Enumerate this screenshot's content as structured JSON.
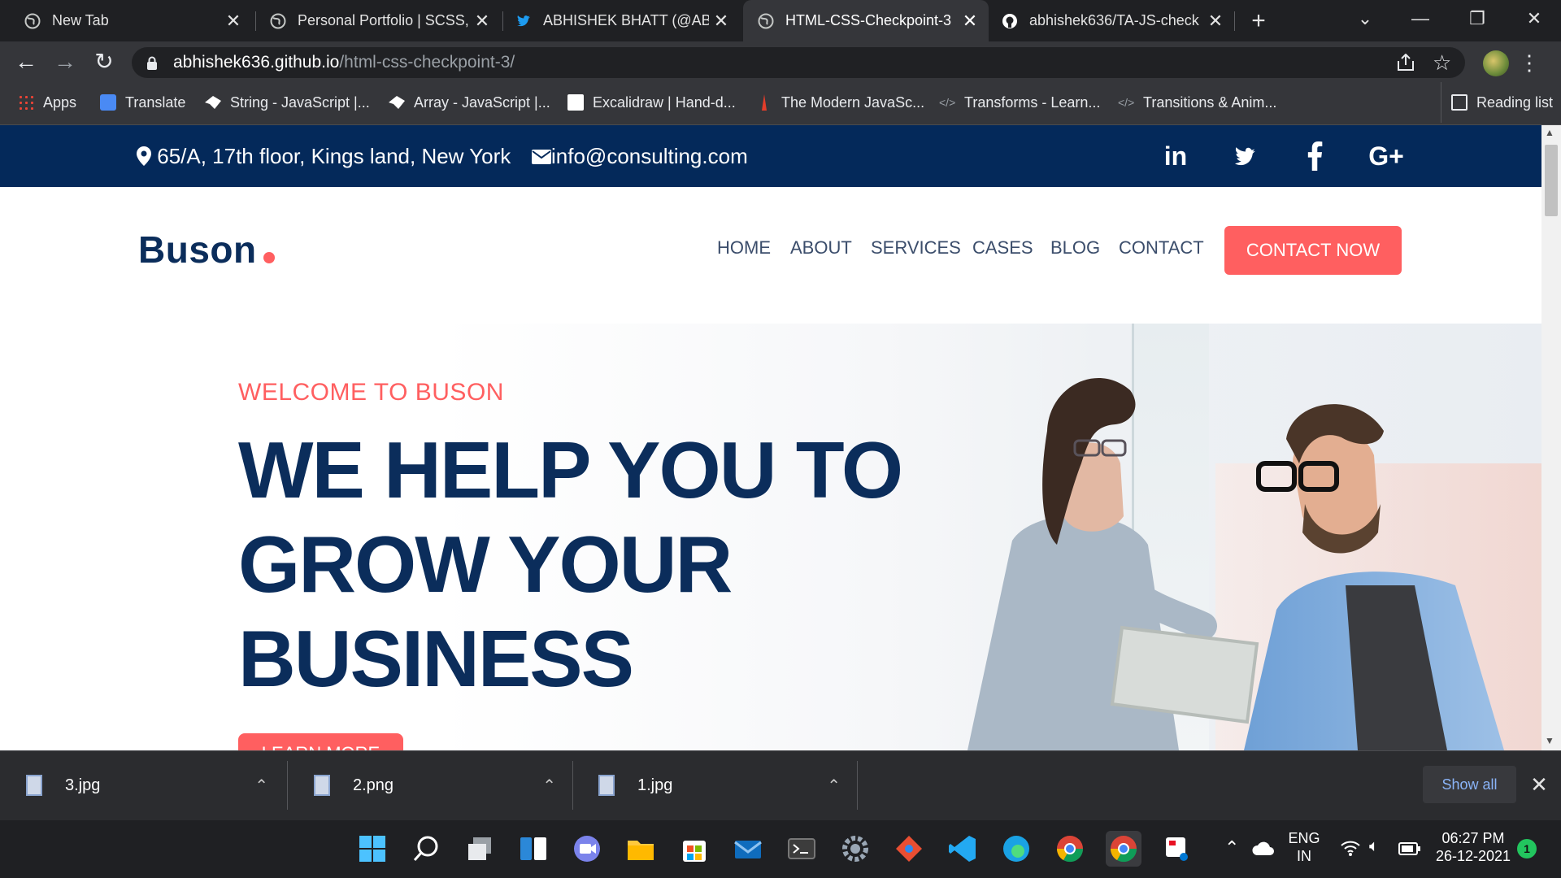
{
  "browser": {
    "tabs": [
      {
        "title": "New Tab",
        "active": false
      },
      {
        "title": "Personal Portfolio | SCSS, ",
        "active": false
      },
      {
        "title": "ABHISHEK BHATT (@ABH",
        "active": false
      },
      {
        "title": "HTML-CSS-Checkpoint-3",
        "active": true
      },
      {
        "title": "abhishek636/TA-JS-check",
        "active": false
      }
    ],
    "new_tab": "+",
    "window_controls": {
      "dropdown": "⌄",
      "minimize": "—",
      "restore": "❐",
      "close": "✕"
    },
    "url_host": "abhishek636.github.io",
    "url_path": "/html-css-checkpoint-3/",
    "bookmarks": [
      {
        "label": "Apps",
        "icon": "apps-grid-icon",
        "color": "#4285f4"
      },
      {
        "label": "Translate",
        "icon": "translate-icon",
        "color": "#4a8af4"
      },
      {
        "label": "String - JavaScript |...",
        "icon": "mdn-icon",
        "color": "#ffffff"
      },
      {
        "label": "Array - JavaScript |...",
        "icon": "mdn-icon",
        "color": "#ffffff"
      },
      {
        "label": "Excalidraw | Hand-d...",
        "icon": "excalidraw-icon",
        "color": "#ffffff"
      },
      {
        "label": "The Modern JavaSc...",
        "icon": "js-info-icon",
        "color": "#e33d2a"
      },
      {
        "label": "Transforms - Learn...",
        "icon": "code-icon",
        "color": "#9aa0a6"
      },
      {
        "label": "Transitions & Anim...",
        "icon": "code-icon",
        "color": "#9aa0a6"
      }
    ],
    "reading_list": "Reading list"
  },
  "page": {
    "topbar": {
      "address": "65/A, 17th floor, Kings land, New York",
      "email": "info@consulting.com",
      "social": [
        "in",
        "t",
        "f",
        "G+"
      ]
    },
    "logo": "Buson",
    "nav": [
      "HOME",
      "ABOUT",
      "SERVICES",
      "CASES",
      "BLOG",
      "CONTACT"
    ],
    "cta": "CONTACT NOW",
    "hero": {
      "welcome": "WELCOME TO BUSON",
      "headline_lines": [
        "WE HELP YOU TO",
        "GROW YOUR",
        "BUSINESS"
      ],
      "button": "LEARN MORE"
    },
    "colors": {
      "navy": "#04295a",
      "accent": "#ff5f60"
    }
  },
  "downloads": {
    "files": [
      "3.jpg",
      "2.png",
      "1.jpg"
    ],
    "show_all": "Show all"
  },
  "taskbar": {
    "lang_top": "ENG",
    "lang_bottom": "IN",
    "time": "06:27 PM",
    "date": "26-12-2021",
    "notification_count": "1"
  }
}
